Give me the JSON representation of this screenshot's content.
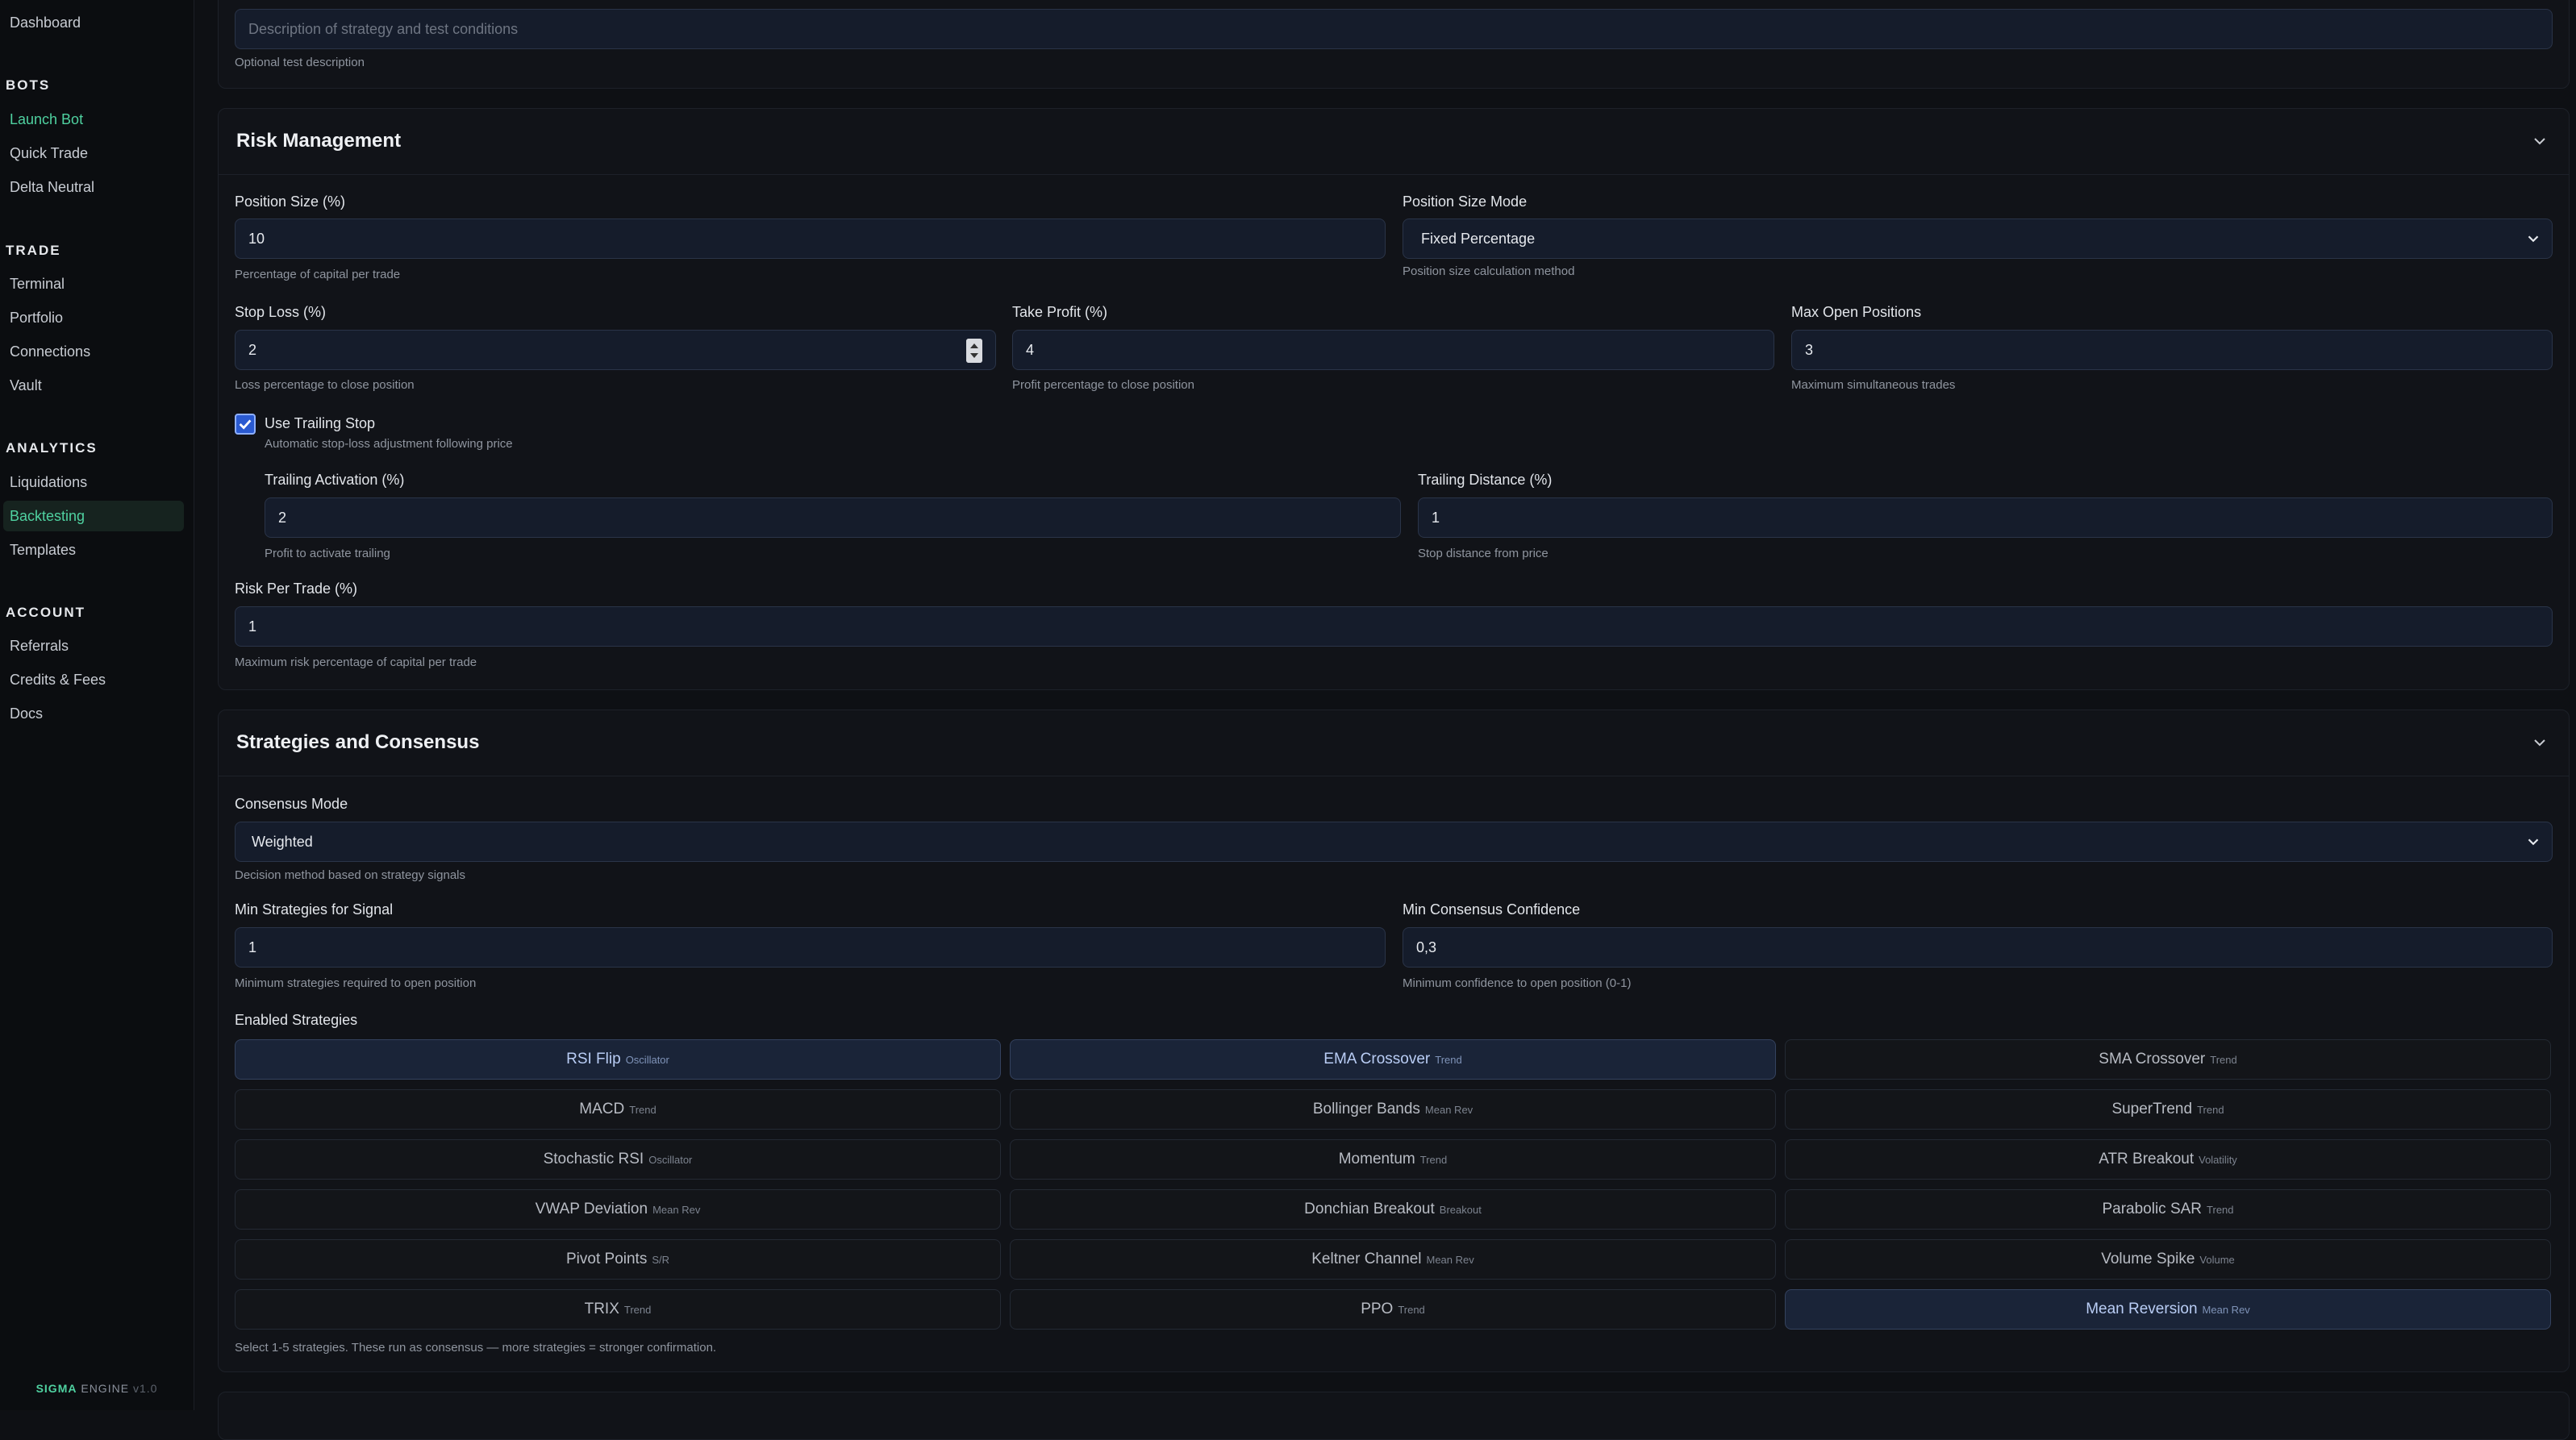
{
  "sidebar": {
    "items_top": [
      {
        "label": "Dashboard"
      }
    ],
    "sections": [
      {
        "title": "BOTS",
        "items": [
          {
            "label": "Launch Bot"
          },
          {
            "label": "Quick Trade"
          },
          {
            "label": "Delta Neutral"
          }
        ]
      },
      {
        "title": "TRADE",
        "items": [
          {
            "label": "Terminal"
          },
          {
            "label": "Portfolio"
          },
          {
            "label": "Connections"
          },
          {
            "label": "Vault"
          }
        ]
      },
      {
        "title": "ANALYTICS",
        "items": [
          {
            "label": "Liquidations"
          },
          {
            "label": "Backtesting"
          },
          {
            "label": "Templates"
          }
        ]
      },
      {
        "title": "ACCOUNT",
        "items": [
          {
            "label": "Referrals"
          },
          {
            "label": "Credits & Fees"
          },
          {
            "label": "Docs"
          }
        ]
      }
    ],
    "brand": {
      "name": "SIGMA",
      "sub": "ENGINE",
      "version": "v1.0"
    }
  },
  "description": {
    "placeholder": "Description of strategy and test conditions",
    "hint": "Optional test description"
  },
  "risk": {
    "title": "Risk Management",
    "position_size": {
      "label": "Position Size (%)",
      "value": "10",
      "hint": "Percentage of capital per trade"
    },
    "position_mode": {
      "label": "Position Size Mode",
      "value": "Fixed Percentage",
      "hint": "Position size calculation method"
    },
    "stop_loss": {
      "label": "Stop Loss (%)",
      "value": "2",
      "hint": "Loss percentage to close position"
    },
    "take_profit": {
      "label": "Take Profit (%)",
      "value": "4",
      "hint": "Profit percentage to close position"
    },
    "max_open": {
      "label": "Max Open Positions",
      "value": "3",
      "hint": "Maximum simultaneous trades"
    },
    "trailing": {
      "label": "Use Trailing Stop",
      "hint": "Automatic stop-loss adjustment following price",
      "checked": true
    },
    "trailing_activation": {
      "label": "Trailing Activation (%)",
      "value": "2",
      "hint": "Profit to activate trailing"
    },
    "trailing_distance": {
      "label": "Trailing Distance (%)",
      "value": "1",
      "hint": "Stop distance from price"
    },
    "risk_per_trade": {
      "label": "Risk Per Trade (%)",
      "value": "1",
      "hint": "Maximum risk percentage of capital per trade"
    }
  },
  "strategies": {
    "title": "Strategies and Consensus",
    "consensus_mode": {
      "label": "Consensus Mode",
      "value": "Weighted",
      "hint": "Decision method based on strategy signals"
    },
    "min_strategies": {
      "label": "Min Strategies for Signal",
      "value": "1",
      "hint": "Minimum strategies required to open position"
    },
    "min_confidence": {
      "label": "Min Consensus Confidence",
      "value": "0,3",
      "hint": "Minimum confidence to open position (0-1)"
    },
    "enabled_label": "Enabled Strategies",
    "list": [
      {
        "name": "RSI Flip",
        "cat": "Oscillator",
        "on": true
      },
      {
        "name": "EMA Crossover",
        "cat": "Trend",
        "on": true
      },
      {
        "name": "SMA Crossover",
        "cat": "Trend",
        "on": false
      },
      {
        "name": "MACD",
        "cat": "Trend",
        "on": false
      },
      {
        "name": "Bollinger Bands",
        "cat": "Mean Rev",
        "on": false
      },
      {
        "name": "SuperTrend",
        "cat": "Trend",
        "on": false
      },
      {
        "name": "Stochastic RSI",
        "cat": "Oscillator",
        "on": false
      },
      {
        "name": "Momentum",
        "cat": "Trend",
        "on": false
      },
      {
        "name": "ATR Breakout",
        "cat": "Volatility",
        "on": false
      },
      {
        "name": "VWAP Deviation",
        "cat": "Mean Rev",
        "on": false
      },
      {
        "name": "Donchian Breakout",
        "cat": "Breakout",
        "on": false
      },
      {
        "name": "Parabolic SAR",
        "cat": "Trend",
        "on": false
      },
      {
        "name": "Pivot Points",
        "cat": "S/R",
        "on": false
      },
      {
        "name": "Keltner Channel",
        "cat": "Mean Rev",
        "on": false
      },
      {
        "name": "Volume Spike",
        "cat": "Volume",
        "on": false
      },
      {
        "name": "TRIX",
        "cat": "Trend",
        "on": false
      },
      {
        "name": "PPO",
        "cat": "Trend",
        "on": false
      },
      {
        "name": "Mean Reversion",
        "cat": "Mean Rev",
        "on": true
      }
    ],
    "footnote": "Select 1-5 strategies. These run as consensus — more strategies = stronger confirmation."
  },
  "colors": {
    "accent": "#4fd1a0",
    "selected_bg": "#1a2438",
    "checkbox": "#2a5ad1"
  }
}
